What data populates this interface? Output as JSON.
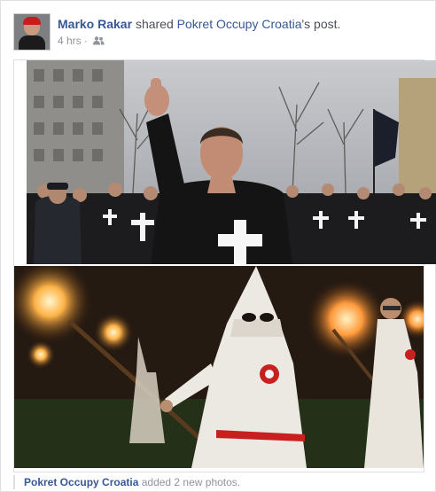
{
  "post": {
    "author": "Marko Rakar",
    "action": "shared",
    "shared_page": "Pokret Occupy Croatia",
    "shared_suffix": "'s post.",
    "time": "4 hrs",
    "separator": "·",
    "audience_icon": "friends-icon"
  },
  "photos": {
    "top_alt": "Photo of marching crowd wearing black shirts with white crosses",
    "bottom_alt": "Photo of hooded figures holding torches at night"
  },
  "footer": {
    "page": "Pokret Occupy Croatia",
    "text": "added 2 new photos."
  }
}
